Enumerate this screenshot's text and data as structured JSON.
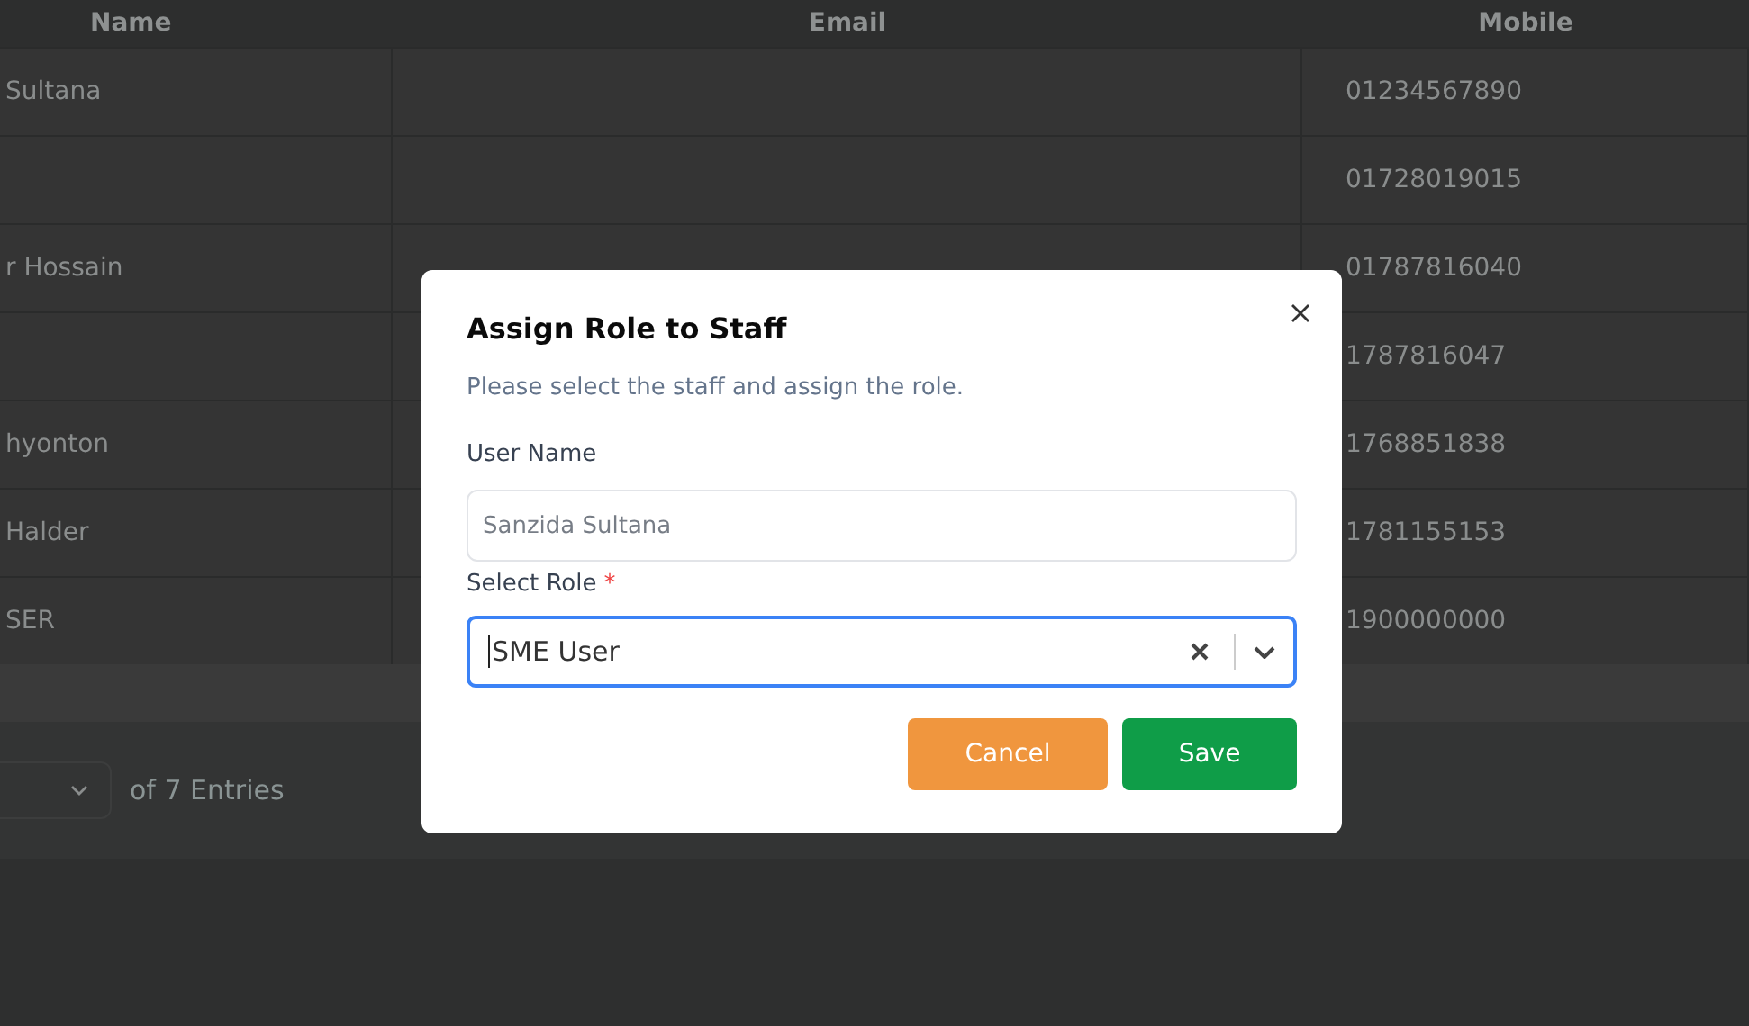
{
  "table": {
    "columns": [
      "Name",
      "Email",
      "Mobile"
    ],
    "rows": [
      {
        "name": "Sultana",
        "mobile": "01234567890"
      },
      {
        "mobile": "01728019015"
      },
      {
        "name": "r Hossain",
        "mobile": "01787816040"
      },
      {
        "mobile": "1787816047"
      },
      {
        "name": "hyonton",
        "mobile": "1768851838"
      },
      {
        "name": "Halder",
        "mobile": "1781155153"
      },
      {
        "name": "SER",
        "mobile": "1900000000"
      }
    ]
  },
  "pagination": {
    "summary": "of 7 Entries"
  },
  "dialog": {
    "title": "Assign Role to Staff",
    "description": "Please select the staff and assign the role.",
    "user_name": {
      "label": "User Name",
      "value": "Sanzida Sultana",
      "disabled": true
    },
    "role": {
      "label": "Select Role",
      "required_mark": "*",
      "value": "SME User",
      "focused": true
    },
    "buttons": [
      {
        "kind": "cancel",
        "label": "Cancel"
      },
      {
        "kind": "save",
        "label": "Save"
      }
    ]
  }
}
